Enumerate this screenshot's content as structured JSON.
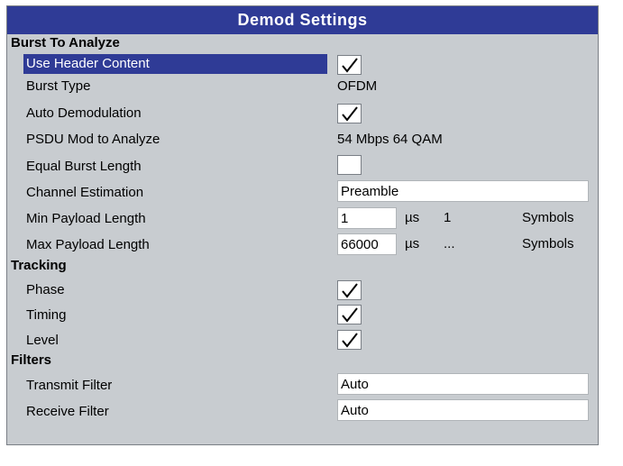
{
  "title": "Demod Settings",
  "sections": {
    "burst": "Burst To Analyze",
    "tracking": "Tracking",
    "filters": "Filters"
  },
  "rows": {
    "use_header": {
      "label": "Use Header Content",
      "checked": true
    },
    "burst_type": {
      "label": "Burst Type",
      "value": "OFDM"
    },
    "auto_demod": {
      "label": "Auto Demodulation",
      "checked": true
    },
    "psdu": {
      "label": "PSDU Mod to Analyze",
      "value": "54 Mbps 64 QAM"
    },
    "equal_burst": {
      "label": "Equal Burst Length",
      "checked": false
    },
    "channel_est": {
      "label": "Channel Estimation",
      "value": "Preamble"
    },
    "min_payload": {
      "label": "Min Payload Length",
      "value": "1",
      "unit": "µs",
      "symbols_value": "1",
      "symbols_label": "Symbols"
    },
    "max_payload": {
      "label": "Max Payload Length",
      "value": "66000",
      "unit": "µs",
      "symbols_value": "...",
      "symbols_label": "Symbols"
    },
    "phase": {
      "label": "Phase",
      "checked": true
    },
    "timing": {
      "label": "Timing",
      "checked": true
    },
    "level": {
      "label": "Level",
      "checked": true
    },
    "transmit_filter": {
      "label": "Transmit Filter",
      "value": "Auto"
    },
    "receive_filter": {
      "label": "Receive Filter",
      "value": "Auto"
    }
  },
  "colors": {
    "title_bg": "#2f3b96",
    "panel_bg": "#c8ccd0",
    "selection": "#2f3b96"
  }
}
